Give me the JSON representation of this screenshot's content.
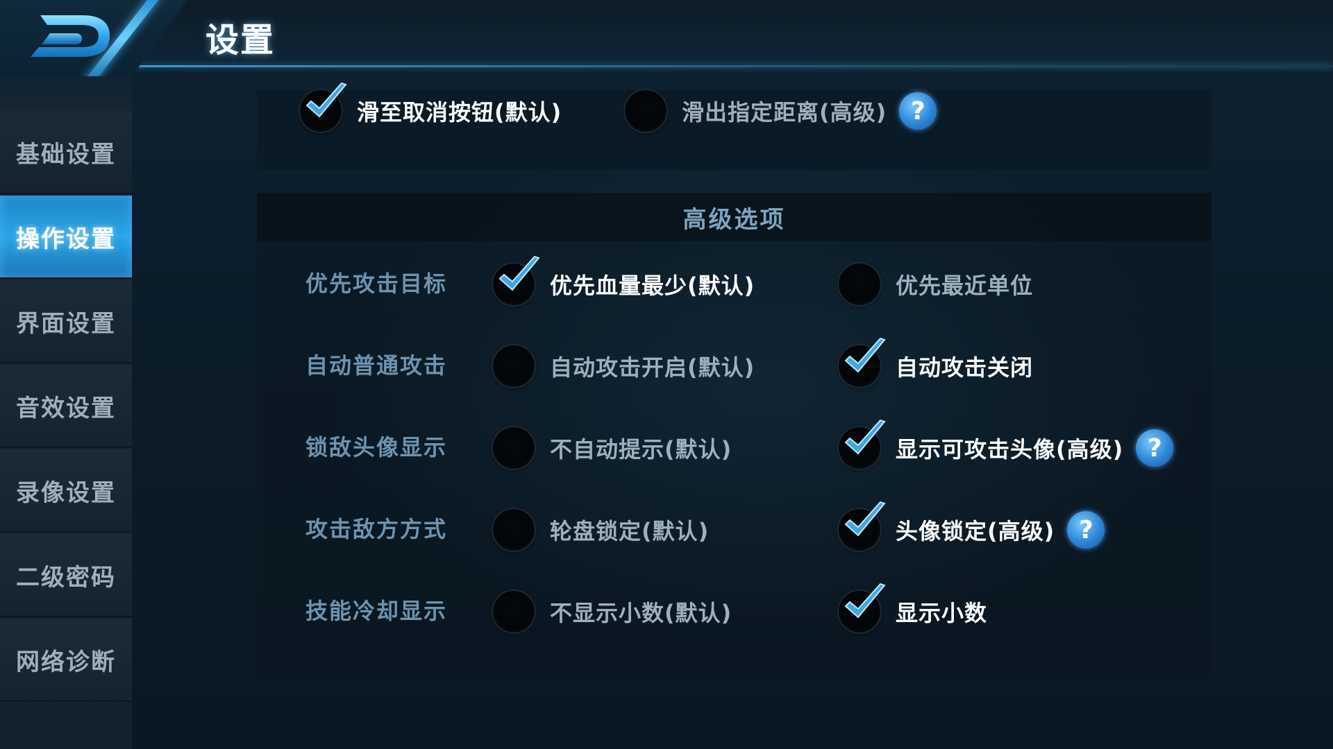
{
  "header": {
    "title": "设置"
  },
  "sidebar": {
    "items": [
      {
        "label": "基础设置",
        "active": false
      },
      {
        "label": "操作设置",
        "active": true
      },
      {
        "label": "界面设置",
        "active": false
      },
      {
        "label": "音效设置",
        "active": false
      },
      {
        "label": "录像设置",
        "active": false
      },
      {
        "label": "二级密码",
        "active": false
      },
      {
        "label": "网络诊断",
        "active": false
      }
    ]
  },
  "top_options": {
    "option1": {
      "label": "滑至取消按钮(默认)",
      "checked": true
    },
    "option2": {
      "label": "滑出指定距离(高级)",
      "checked": false
    },
    "help": "?"
  },
  "advanced": {
    "title": "高级选项",
    "rows": [
      {
        "label": "优先攻击目标",
        "option1": "优先血量最少(默认)",
        "option2": "优先最近单位",
        "selected": 1
      },
      {
        "label": "自动普通攻击",
        "option1": "自动攻击开启(默认)",
        "option2": "自动攻击关闭",
        "selected": 2
      },
      {
        "label": "锁敌头像显示",
        "option1": "不自动提示(默认)",
        "option2": "显示可攻击头像(高级)",
        "selected": 2,
        "help": "?"
      },
      {
        "label": "攻击敌方方式",
        "option1": "轮盘锁定(默认)",
        "option2": "头像锁定(高级)",
        "selected": 2,
        "help": "?"
      },
      {
        "label": "技能冷却显示",
        "option1": "不显示小数(默认)",
        "option2": "显示小数",
        "selected": 2
      }
    ]
  },
  "icons": {
    "back": "back-arrow-icon",
    "check": "checkmark-icon",
    "help": "question-mark-icon"
  },
  "colors": {
    "accent": "#2aa6e6",
    "check": "#3fa8e0",
    "help_badge": "#2d86d6"
  }
}
